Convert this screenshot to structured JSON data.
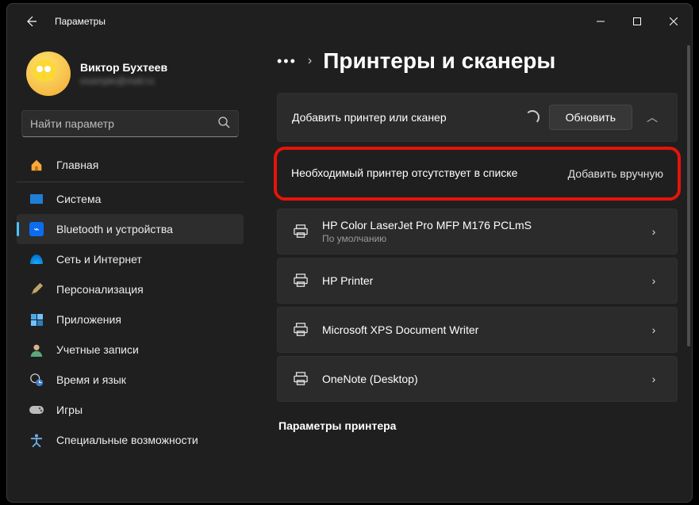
{
  "window_title": "Параметры",
  "profile": {
    "name": "Виктор Бухтеев",
    "sub": "example@mail.ru"
  },
  "search": {
    "placeholder": "Найти параметр"
  },
  "sidebar": {
    "items": [
      {
        "id": "home",
        "label": "Главная"
      },
      {
        "id": "system",
        "label": "Система"
      },
      {
        "id": "bt",
        "label": "Bluetooth и устройства",
        "selected": true
      },
      {
        "id": "net",
        "label": "Сеть и Интернет"
      },
      {
        "id": "pers",
        "label": "Персонализация"
      },
      {
        "id": "apps",
        "label": "Приложения"
      },
      {
        "id": "acct",
        "label": "Учетные записи"
      },
      {
        "id": "time",
        "label": "Время и язык"
      },
      {
        "id": "game",
        "label": "Игры"
      },
      {
        "id": "access",
        "label": "Специальные возможности"
      }
    ]
  },
  "page": {
    "title": "Принтеры и сканеры"
  },
  "add": {
    "title": "Добавить принтер или сканер",
    "button": "Обновить",
    "missing_text": "Необходимый принтер отсутствует в списке",
    "manual_link": "Добавить вручную"
  },
  "printers": [
    {
      "name": "HP Color LaserJet Pro MFP M176 PCLmS",
      "sub": "По умолчанию"
    },
    {
      "name": "HP Printer"
    },
    {
      "name": "Microsoft XPS Document Writer"
    },
    {
      "name": "OneNote (Desktop)"
    }
  ],
  "section_label": "Параметры принтера"
}
